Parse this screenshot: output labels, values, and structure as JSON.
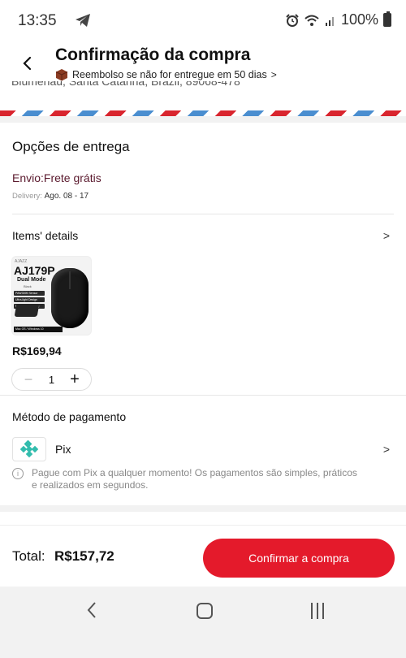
{
  "status_bar": {
    "time": "13:35",
    "battery_text": "100%",
    "icons": [
      "telegram-icon",
      "alarm-icon",
      "wifi-icon",
      "signal-icon",
      "battery-icon"
    ]
  },
  "header": {
    "title": "Confirmação da compra",
    "refund_text": "Reembolso se não for entregue em 50 dias",
    "refund_chevron": ">"
  },
  "address_partial": "Blumenau, Santa Catarina, Brazil, 89068-478",
  "delivery": {
    "section_title": "Opções de entrega",
    "shipping": "Envio:Frete grátis",
    "date_label": "Delivery:",
    "date_value": "Ago. 08 - 17"
  },
  "items": {
    "section_title": "Items' details",
    "chevron": ">",
    "product": {
      "thumb_brand": "AJAZZ",
      "thumb_model": "AJ179P",
      "thumb_mode": "Dual Mode",
      "thumb_color": "Black",
      "thumb_features": [
        "PAW3395 Sensor",
        "Ultra-light Design",
        "Magnetic Charging Base"
      ],
      "thumb_compat": "Mac OS / Windows 10",
      "price": "R$169,94",
      "quantity": "1",
      "minus": "−",
      "plus": "+"
    }
  },
  "payment": {
    "section_title": "Método de pagamento",
    "method": "Pix",
    "chevron": ">",
    "note": "Pague com Pix a qualquer momento! Os pagamentos são simples, práticos e realizados em segundos.",
    "info_glyph": "i"
  },
  "footer": {
    "total_label": "Total:",
    "total_value": "R$157,72",
    "confirm_label": "Confirmar a compra"
  },
  "colors": {
    "accent": "#e41a2b",
    "pix": "#32bcad",
    "shipping_text": "#5b1a2e"
  }
}
